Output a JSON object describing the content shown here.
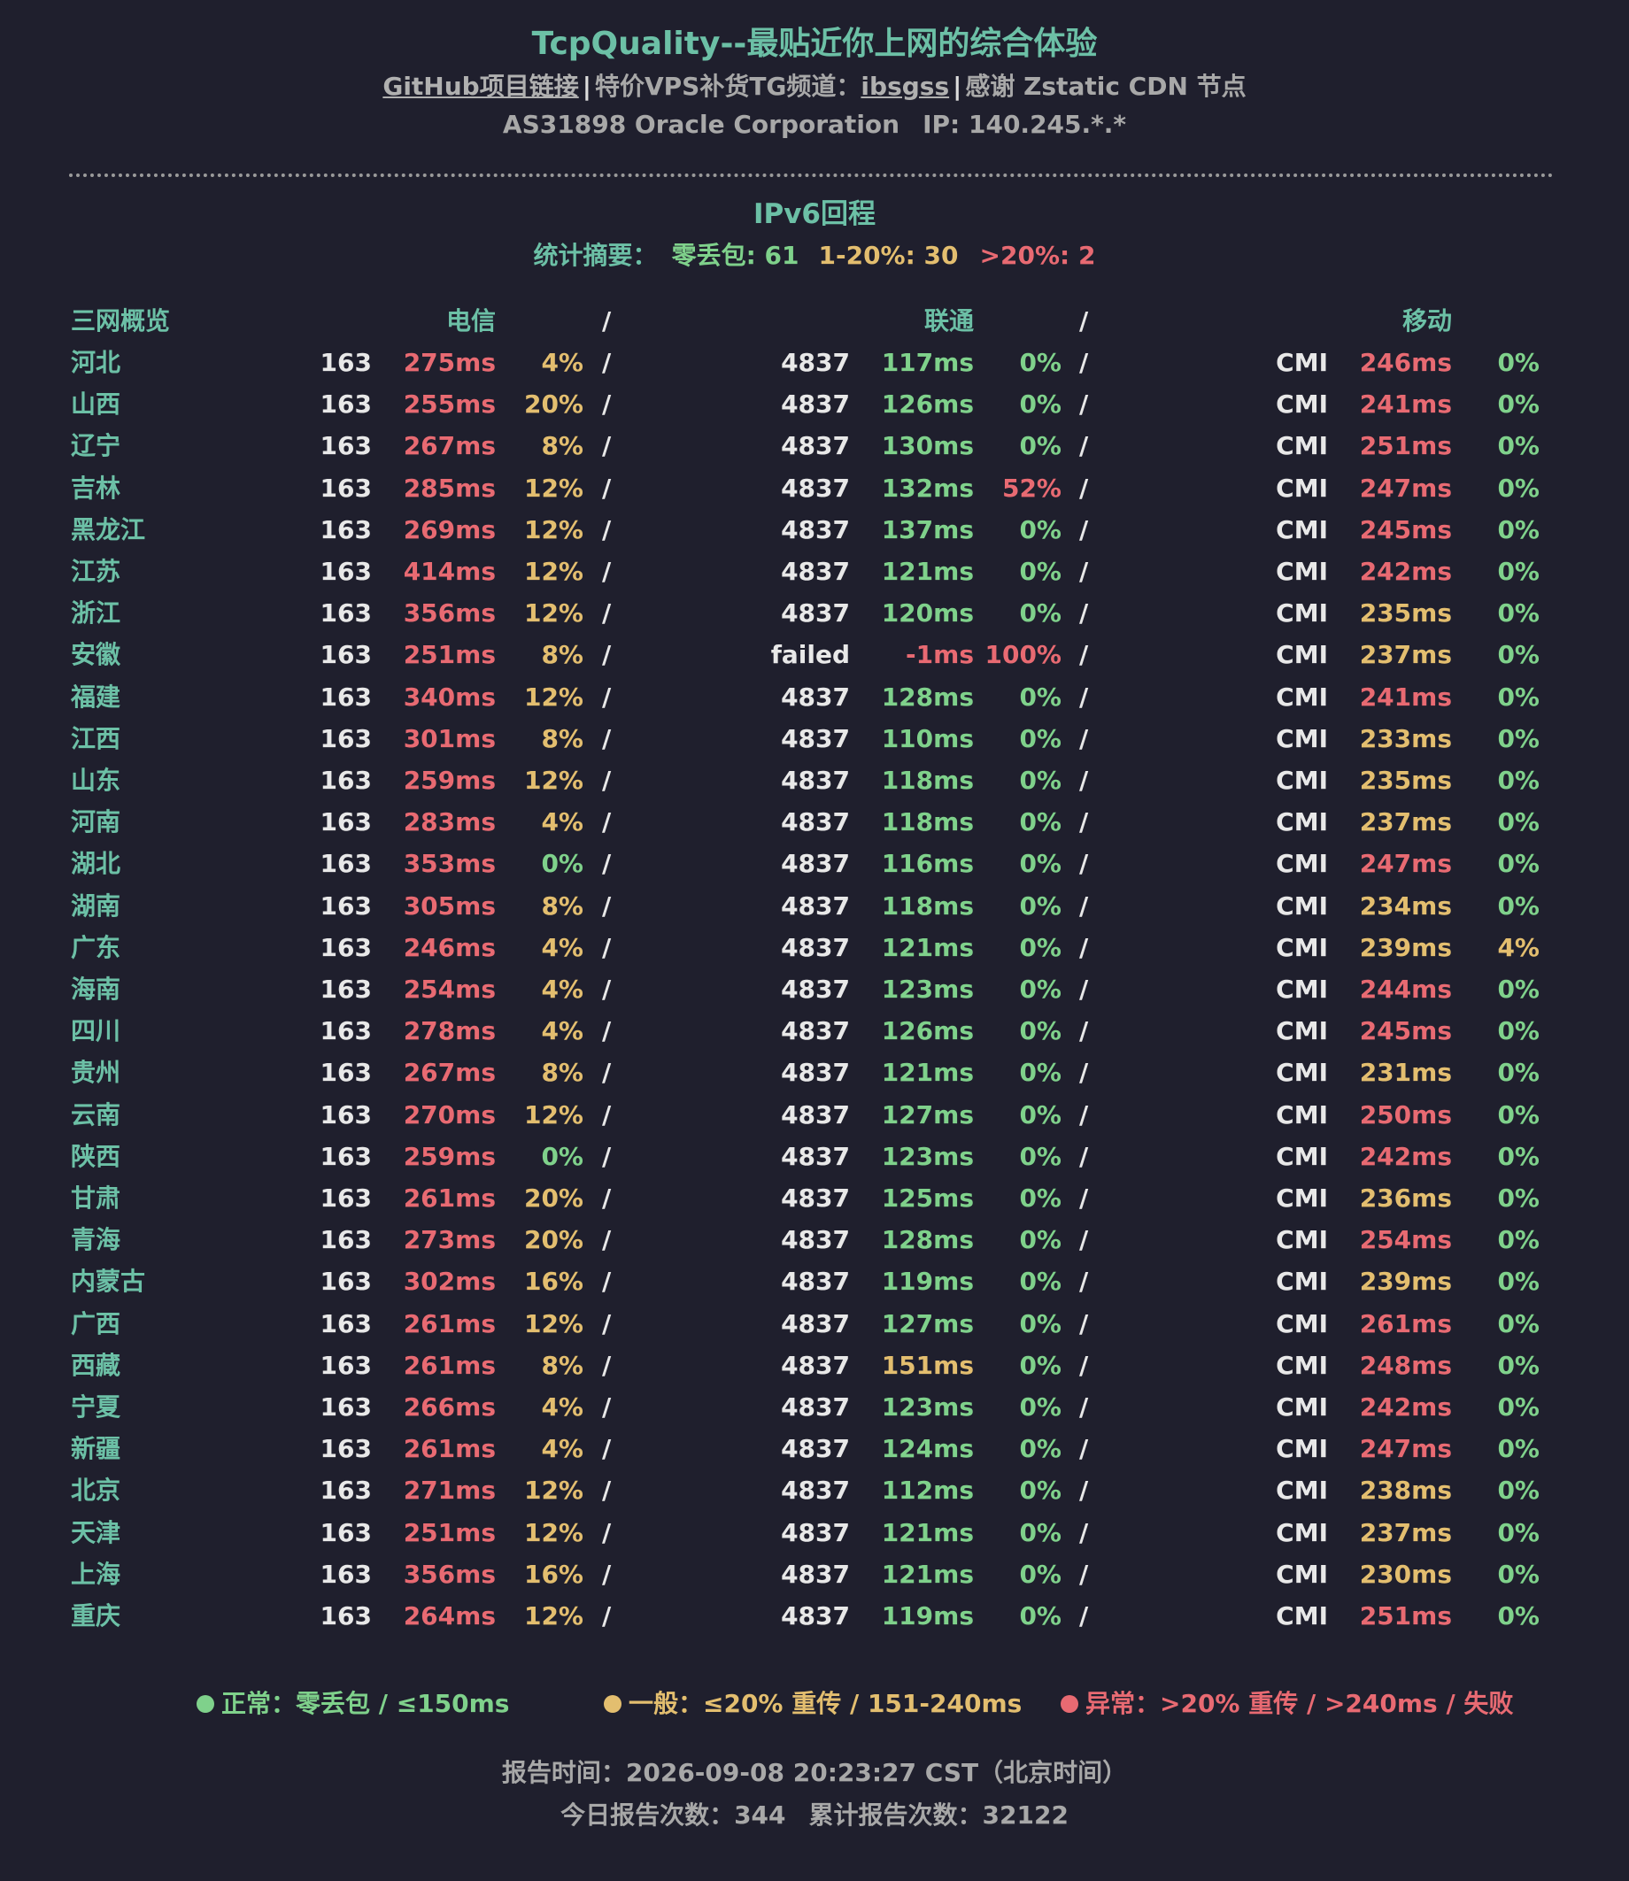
{
  "header": {
    "title": "TcpQuality--最贴近你上网的综合体验",
    "github_link": "GitHub项目链接",
    "separator": "|",
    "tg_label": "特价VPS补货TG频道：",
    "tg_link": "ibsgss",
    "thanks": "感谢 Zstatic CDN 节点",
    "as_info": "AS31898 Oracle Corporation",
    "ip_info": "IP: 140.245.*.*"
  },
  "section": {
    "title": "IPv6回程",
    "summary_label": "统计摘要：",
    "summary_zero": "零丢包: 61",
    "summary_mid": "1-20%: 30",
    "summary_high": ">20%: 2"
  },
  "table": {
    "headers": {
      "region": "三网概览",
      "telecom": "电信",
      "sep": "/",
      "unicom": "联通",
      "mobile": "移动"
    },
    "rows": [
      [
        "河北",
        "163",
        "275ms",
        "4%",
        "4837",
        "117ms",
        "0%",
        "CMI",
        "246ms",
        "0%"
      ],
      [
        "山西",
        "163",
        "255ms",
        "20%",
        "4837",
        "126ms",
        "0%",
        "CMI",
        "241ms",
        "0%"
      ],
      [
        "辽宁",
        "163",
        "267ms",
        "8%",
        "4837",
        "130ms",
        "0%",
        "CMI",
        "251ms",
        "0%"
      ],
      [
        "吉林",
        "163",
        "285ms",
        "12%",
        "4837",
        "132ms",
        "52%",
        "CMI",
        "247ms",
        "0%"
      ],
      [
        "黑龙江",
        "163",
        "269ms",
        "12%",
        "4837",
        "137ms",
        "0%",
        "CMI",
        "245ms",
        "0%"
      ],
      [
        "江苏",
        "163",
        "414ms",
        "12%",
        "4837",
        "121ms",
        "0%",
        "CMI",
        "242ms",
        "0%"
      ],
      [
        "浙江",
        "163",
        "356ms",
        "12%",
        "4837",
        "120ms",
        "0%",
        "CMI",
        "235ms",
        "0%"
      ],
      [
        "安徽",
        "163",
        "251ms",
        "8%",
        "failed",
        "-1ms",
        "100%",
        "CMI",
        "237ms",
        "0%"
      ],
      [
        "福建",
        "163",
        "340ms",
        "12%",
        "4837",
        "128ms",
        "0%",
        "CMI",
        "241ms",
        "0%"
      ],
      [
        "江西",
        "163",
        "301ms",
        "8%",
        "4837",
        "110ms",
        "0%",
        "CMI",
        "233ms",
        "0%"
      ],
      [
        "山东",
        "163",
        "259ms",
        "12%",
        "4837",
        "118ms",
        "0%",
        "CMI",
        "235ms",
        "0%"
      ],
      [
        "河南",
        "163",
        "283ms",
        "4%",
        "4837",
        "118ms",
        "0%",
        "CMI",
        "237ms",
        "0%"
      ],
      [
        "湖北",
        "163",
        "353ms",
        "0%",
        "4837",
        "116ms",
        "0%",
        "CMI",
        "247ms",
        "0%"
      ],
      [
        "湖南",
        "163",
        "305ms",
        "8%",
        "4837",
        "118ms",
        "0%",
        "CMI",
        "234ms",
        "0%"
      ],
      [
        "广东",
        "163",
        "246ms",
        "4%",
        "4837",
        "121ms",
        "0%",
        "CMI",
        "239ms",
        "4%"
      ],
      [
        "海南",
        "163",
        "254ms",
        "4%",
        "4837",
        "123ms",
        "0%",
        "CMI",
        "244ms",
        "0%"
      ],
      [
        "四川",
        "163",
        "278ms",
        "4%",
        "4837",
        "126ms",
        "0%",
        "CMI",
        "245ms",
        "0%"
      ],
      [
        "贵州",
        "163",
        "267ms",
        "8%",
        "4837",
        "121ms",
        "0%",
        "CMI",
        "231ms",
        "0%"
      ],
      [
        "云南",
        "163",
        "270ms",
        "12%",
        "4837",
        "127ms",
        "0%",
        "CMI",
        "250ms",
        "0%"
      ],
      [
        "陕西",
        "163",
        "259ms",
        "0%",
        "4837",
        "123ms",
        "0%",
        "CMI",
        "242ms",
        "0%"
      ],
      [
        "甘肃",
        "163",
        "261ms",
        "20%",
        "4837",
        "125ms",
        "0%",
        "CMI",
        "236ms",
        "0%"
      ],
      [
        "青海",
        "163",
        "273ms",
        "20%",
        "4837",
        "128ms",
        "0%",
        "CMI",
        "254ms",
        "0%"
      ],
      [
        "内蒙古",
        "163",
        "302ms",
        "16%",
        "4837",
        "119ms",
        "0%",
        "CMI",
        "239ms",
        "0%"
      ],
      [
        "广西",
        "163",
        "261ms",
        "12%",
        "4837",
        "127ms",
        "0%",
        "CMI",
        "261ms",
        "0%"
      ],
      [
        "西藏",
        "163",
        "261ms",
        "8%",
        "4837",
        "151ms",
        "0%",
        "CMI",
        "248ms",
        "0%"
      ],
      [
        "宁夏",
        "163",
        "266ms",
        "4%",
        "4837",
        "123ms",
        "0%",
        "CMI",
        "242ms",
        "0%"
      ],
      [
        "新疆",
        "163",
        "261ms",
        "4%",
        "4837",
        "124ms",
        "0%",
        "CMI",
        "247ms",
        "0%"
      ],
      [
        "北京",
        "163",
        "271ms",
        "12%",
        "4837",
        "112ms",
        "0%",
        "CMI",
        "238ms",
        "0%"
      ],
      [
        "天津",
        "163",
        "251ms",
        "12%",
        "4837",
        "121ms",
        "0%",
        "CMI",
        "237ms",
        "0%"
      ],
      [
        "上海",
        "163",
        "356ms",
        "16%",
        "4837",
        "121ms",
        "0%",
        "CMI",
        "230ms",
        "0%"
      ],
      [
        "重庆",
        "163",
        "264ms",
        "12%",
        "4837",
        "119ms",
        "0%",
        "CMI",
        "251ms",
        "0%"
      ]
    ]
  },
  "legend": {
    "normal": "正常：零丢包 / ≤150ms",
    "fair": "一般：≤20% 重传 / 151-240ms",
    "abnormal": "异常：>20% 重传 / >240ms / 失败"
  },
  "footer": {
    "report_time": "报告时间：2026-09-08 20:23:27 CST（北京时间）",
    "today_count": "今日报告次数：344",
    "total_count": "累计报告次数：32122"
  },
  "colors": {
    "background": "#1f1f2d",
    "accent": "#6cc0a6",
    "good": "#7fd18b",
    "warn": "#e3be6f",
    "bad": "#e86a72"
  }
}
